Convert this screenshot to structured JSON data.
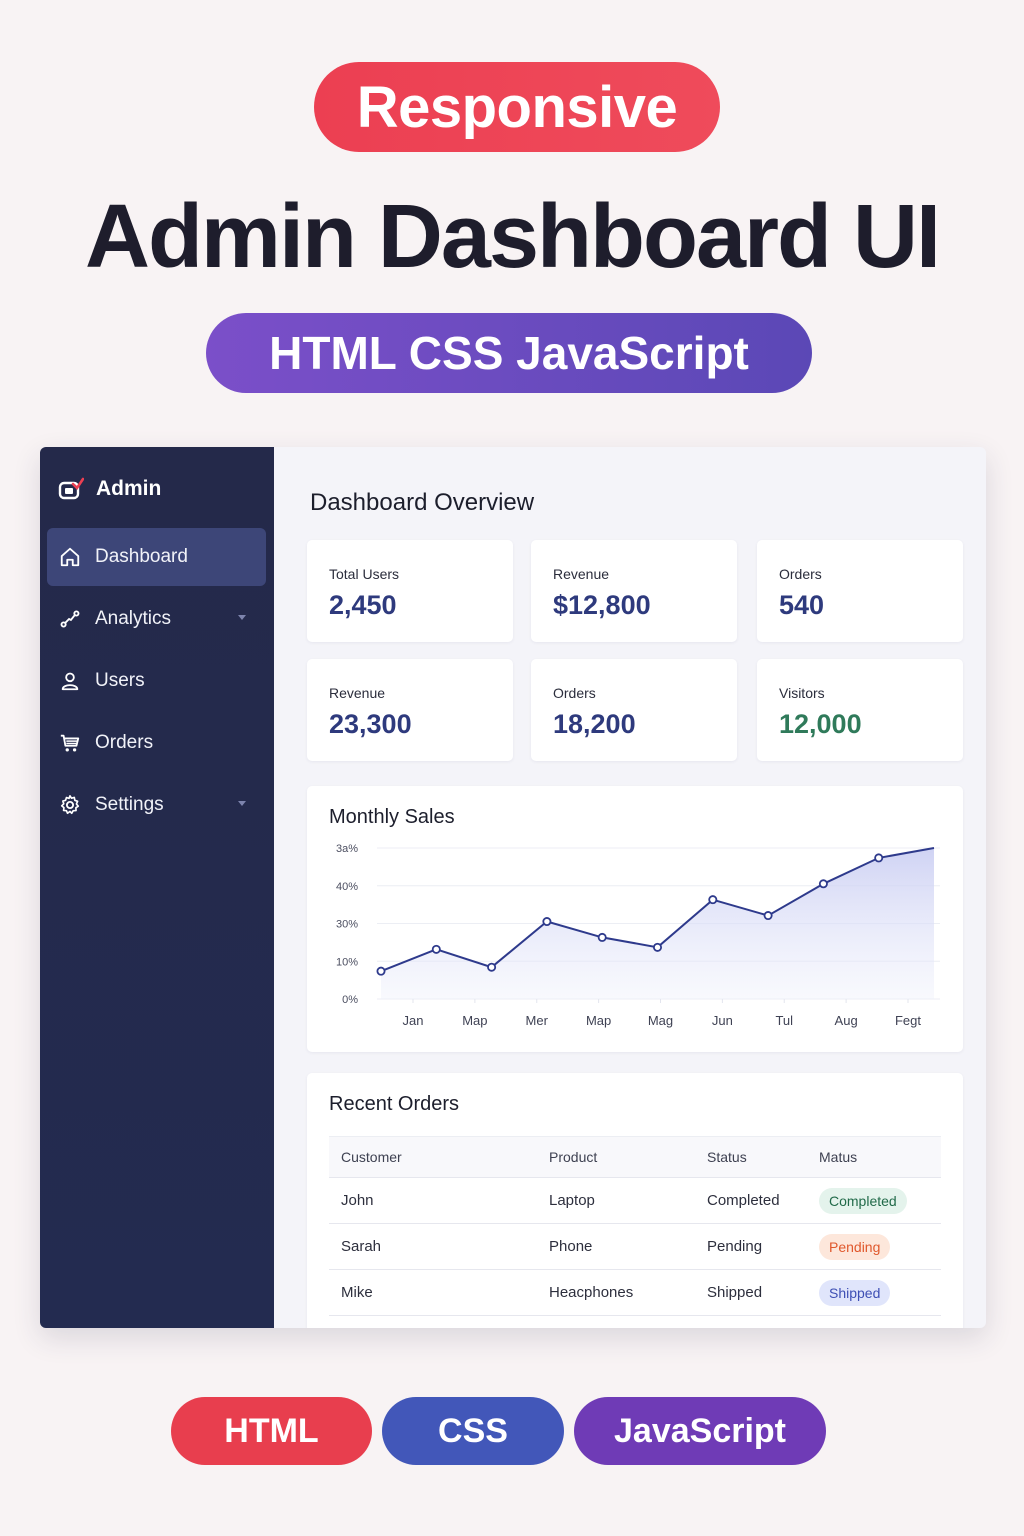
{
  "hero": {
    "badge": "Responsive",
    "title": "Admin Dashboard UI",
    "stack": "HTML CSS JavaScript"
  },
  "sidebar": {
    "brand": "Admin",
    "items": [
      {
        "label": "Dashboard",
        "icon": "home-icon",
        "active": true
      },
      {
        "label": "Analytics",
        "icon": "analytics-icon",
        "has_chevron": true
      },
      {
        "label": "Users",
        "icon": "user-icon"
      },
      {
        "label": "Orders",
        "icon": "cart-icon"
      },
      {
        "label": "Settings",
        "icon": "gear-icon",
        "has_chevron": true
      }
    ]
  },
  "main": {
    "title": "Dashboard Overview",
    "stats": [
      {
        "label": "Total Users",
        "value": "2,450"
      },
      {
        "label": "Revenue",
        "value": "$12,800"
      },
      {
        "label": "Orders",
        "value": "540"
      },
      {
        "label": "Revenue",
        "value": "23,300"
      },
      {
        "label": "Orders",
        "value": "18,200"
      },
      {
        "label": "Visitors",
        "value": "12,000"
      }
    ],
    "sales_title": "Monthly Sales",
    "orders_title": "Recent Orders",
    "orders_table": {
      "headers": [
        "Customer",
        "Product",
        "Status",
        "Matus"
      ],
      "rows": [
        {
          "customer": "John",
          "product": "Laptop",
          "status": "Completed",
          "badge": "Completed"
        },
        {
          "customer": "Sarah",
          "product": "Phone",
          "status": "Pending",
          "badge": "Pending"
        },
        {
          "customer": "Mike",
          "product": "Heacphones",
          "status": "Shipped",
          "badge": "Shipped"
        }
      ]
    }
  },
  "chart_data": {
    "type": "line",
    "title": "Monthly Sales",
    "categories": [
      "Jan",
      "Map",
      "Mer",
      "Map",
      "Mag",
      "Jun",
      "Tul",
      "Aug",
      "Fegt"
    ],
    "y_tick_labels": [
      "0%",
      "10%",
      "30%",
      "40%",
      "3a%"
    ],
    "series": [
      {
        "values": [
          7,
          12.5,
          8,
          19.5,
          15.5,
          13,
          25,
          21,
          29,
          35.5,
          38
        ]
      }
    ],
    "ylim": [
      0,
      38
    ],
    "grid": true,
    "legend": "none"
  },
  "footer": {
    "pills": [
      "HTML",
      "CSS",
      "JavaScript"
    ]
  },
  "colors": {
    "accent_red": "#ec3f52",
    "accent_purple": "#6f3bb6",
    "accent_blue": "#4257b9",
    "sidebar_bg": "#24294a",
    "line": "#2e3a8c"
  }
}
